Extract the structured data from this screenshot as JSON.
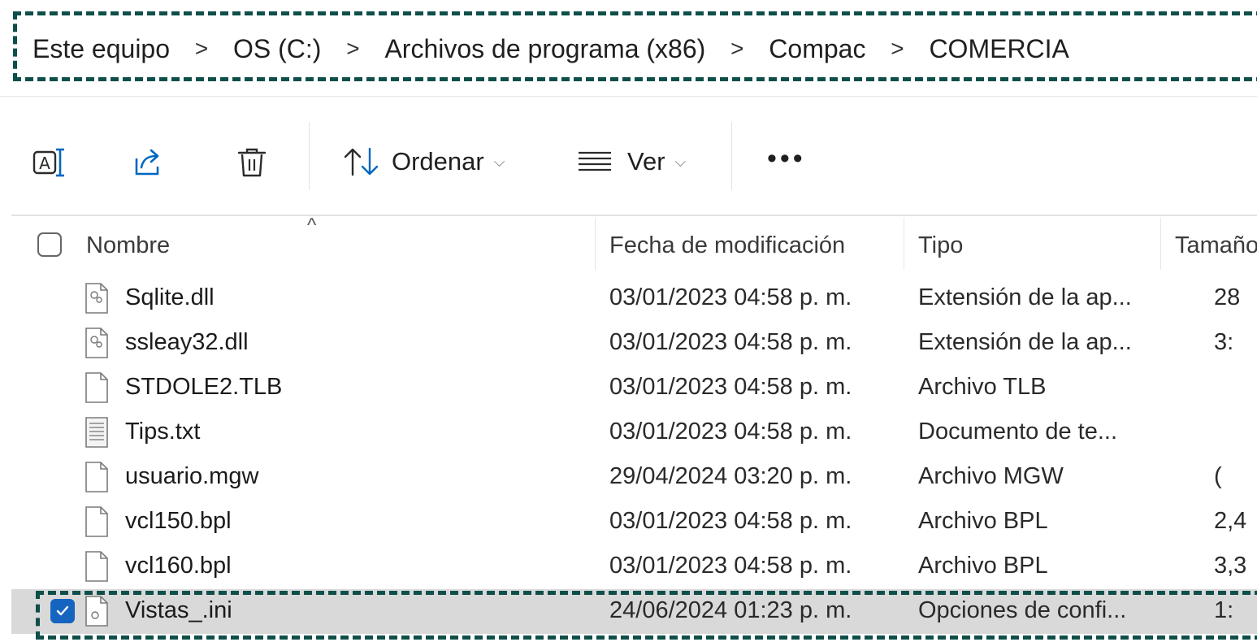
{
  "breadcrumb": {
    "items": [
      "Este equipo",
      "OS (C:)",
      "Archivos de programa (x86)",
      "Compac",
      "COMERCIA"
    ],
    "separator": ">"
  },
  "toolbar": {
    "rename_icon": "rename-icon",
    "share_icon": "share-icon",
    "delete_icon": "trash-icon",
    "sort_label": "Ordenar",
    "view_label": "Ver",
    "more_label": "•••"
  },
  "columns": {
    "name": "Nombre",
    "date": "Fecha de modificación",
    "type": "Tipo",
    "size": "Tamaño"
  },
  "files": [
    {
      "name": "Sqlite.dll",
      "date": "03/01/2023 04:58 p. m.",
      "type": "Extensión de la ap...",
      "size": "28",
      "icon": "dll-file-icon"
    },
    {
      "name": "ssleay32.dll",
      "date": "03/01/2023 04:58 p. m.",
      "type": "Extensión de la ap...",
      "size": "3:",
      "icon": "dll-file-icon"
    },
    {
      "name": "STDOLE2.TLB",
      "date": "03/01/2023 04:58 p. m.",
      "type": "Archivo TLB",
      "size": "",
      "icon": "blank-file-icon"
    },
    {
      "name": "Tips.txt",
      "date": "03/01/2023 04:58 p. m.",
      "type": "Documento de te...",
      "size": "",
      "icon": "text-file-icon"
    },
    {
      "name": "usuario.mgw",
      "date": "29/04/2024 03:20 p. m.",
      "type": "Archivo MGW",
      "size": "(",
      "icon": "blank-file-icon"
    },
    {
      "name": "vcl150.bpl",
      "date": "03/01/2023 04:58 p. m.",
      "type": "Archivo BPL",
      "size": "2,4",
      "icon": "blank-file-icon"
    },
    {
      "name": "vcl160.bpl",
      "date": "03/01/2023 04:58 p. m.",
      "type": "Archivo BPL",
      "size": "3,3",
      "icon": "blank-file-icon"
    },
    {
      "name": "Vistas_.ini",
      "date": "24/06/2024 01:23 p. m.",
      "type": "Opciones de confi...",
      "size": "1:",
      "icon": "ini-file-icon",
      "selected": true
    }
  ],
  "colors": {
    "highlight_dash": "#0f4f4a",
    "selected_row": "#d9d9d9",
    "checkbox_checked": "#1565c0"
  }
}
